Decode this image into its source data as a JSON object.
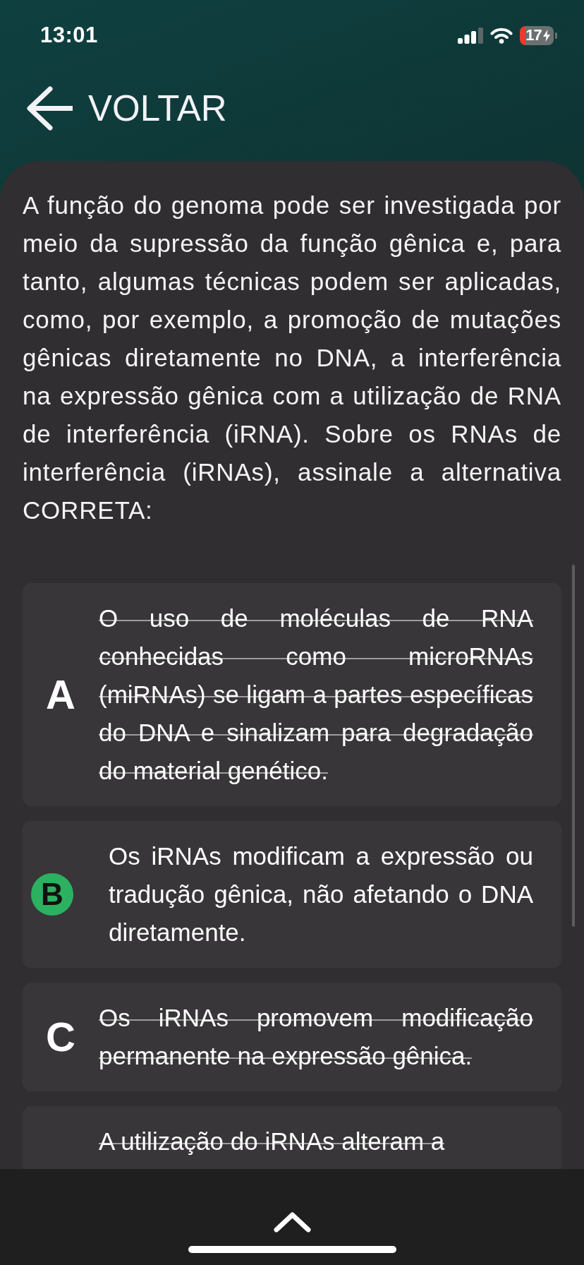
{
  "status_bar": {
    "time": "13:01",
    "battery": "17"
  },
  "header": {
    "back_label": "VOLTAR"
  },
  "question": {
    "text": "A função do genoma pode ser investigada por meio da supressão da função gênica e, para tanto, algumas técnicas podem ser aplicadas, como, por exemplo, a promoção de mutações gênicas diretamente no DNA, a interferência na expressão gênica com a utilização de RNA de interferência (iRNA). Sobre os RNAs de interferência (iRNAs), assinale a alternativa CORRETA:"
  },
  "options": [
    {
      "letter": "A",
      "text": "O uso de moléculas de RNA conhecidas como microRNAs (miRNAs) se ligam a partes específicas do DNA e sinalizam para degradação do material genético.",
      "selected": false,
      "struck_out": true
    },
    {
      "letter": "B",
      "text": "Os iRNAs modificam a expressão ou tradução gênica, não afetando o DNA diretamente.",
      "selected": true,
      "struck_out": false
    },
    {
      "letter": "C",
      "text": "Os iRNAs promovem modificação permanente na expressão gênica.",
      "selected": false,
      "struck_out": true
    },
    {
      "text": "A utilização do iRNAs alteram a",
      "selected": false,
      "struck_out": true
    }
  ]
}
